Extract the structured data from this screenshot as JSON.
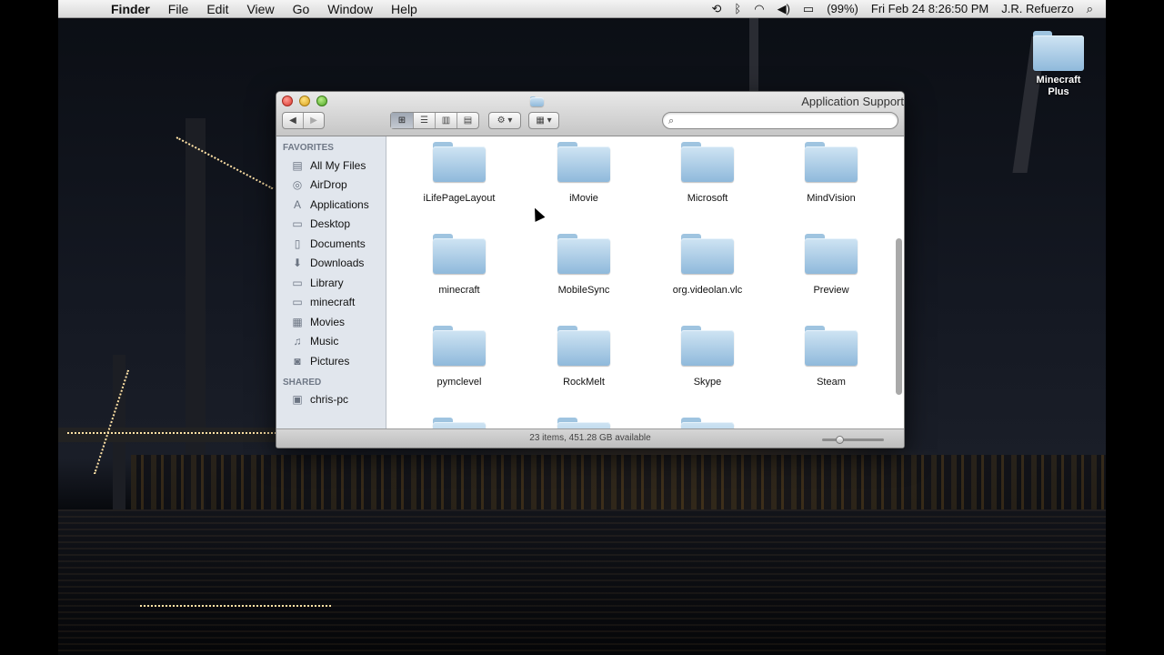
{
  "menubar": {
    "app": "Finder",
    "items": [
      "File",
      "Edit",
      "View",
      "Go",
      "Window",
      "Help"
    ],
    "battery": "(99%)",
    "datetime": "Fri Feb 24  8:26:50 PM",
    "user": "J.R. Refuerzo"
  },
  "desktop": {
    "icon_label": "Minecraft Plus"
  },
  "window": {
    "title": "Application Support",
    "search_placeholder": "",
    "status": "23 items, 451.28 GB available",
    "zoom_level": 0.25
  },
  "sidebar": {
    "favorites_header": "FAVORITES",
    "favorites": [
      {
        "label": "All My Files",
        "icon": "all-files-icon"
      },
      {
        "label": "AirDrop",
        "icon": "airdrop-icon"
      },
      {
        "label": "Applications",
        "icon": "applications-icon"
      },
      {
        "label": "Desktop",
        "icon": "desktop-icon"
      },
      {
        "label": "Documents",
        "icon": "documents-icon"
      },
      {
        "label": "Downloads",
        "icon": "downloads-icon"
      },
      {
        "label": "Library",
        "icon": "folder-icon"
      },
      {
        "label": "minecraft",
        "icon": "folder-icon"
      },
      {
        "label": "Movies",
        "icon": "movies-icon"
      },
      {
        "label": "Music",
        "icon": "music-icon"
      },
      {
        "label": "Pictures",
        "icon": "pictures-icon"
      }
    ],
    "shared_header": "SHARED",
    "shared": [
      {
        "label": "chris-pc",
        "icon": "computer-icon"
      }
    ]
  },
  "folders": [
    "iLifePageLayout",
    "iMovie",
    "Microsoft",
    "MindVision",
    "minecraft",
    "MobileSync",
    "org.videolan.vlc",
    "Preview",
    "pymclevel",
    "RockMelt",
    "Skype",
    "Steam",
    "",
    "",
    ""
  ]
}
